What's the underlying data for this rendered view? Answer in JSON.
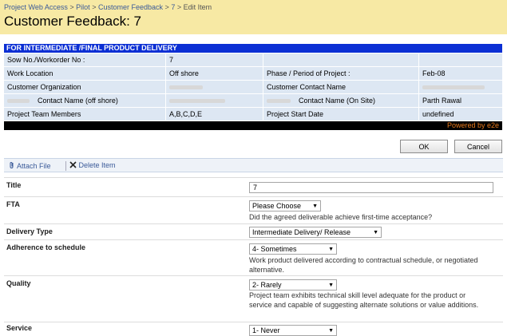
{
  "breadcrumb": [
    "Project Web Access",
    "Pilot",
    "Customer Feedback",
    "7",
    "Edit Item"
  ],
  "breadcrumb_sep": ">",
  "page_title": "Customer Feedback: 7",
  "info": {
    "header": "FOR INTERMEDIATE /FINAL PRODUCT DELIVERY",
    "rows": [
      [
        "Sow No./Workorder No :",
        "7",
        "",
        ""
      ],
      [
        "Work Location",
        "Off shore",
        "Phase / Period of Project :",
        "Feb-08"
      ],
      [
        "Customer Organization",
        "",
        "Customer Contact Name",
        ""
      ],
      [
        "Contact Name (off shore)",
        "",
        "Contact Name (On Site)",
        "Parth Rawal"
      ],
      [
        "Project Team Members",
        "A,B,C,D,E",
        "Project Start Date",
        "undefined"
      ]
    ],
    "powered": "Powered by e2e"
  },
  "buttons": {
    "ok": "OK",
    "cancel": "Cancel"
  },
  "toolbar": {
    "attach": "Attach File",
    "delete": "Delete Item"
  },
  "form": {
    "title_label": "Title",
    "title_value": "7",
    "fta_label": "FTA",
    "fta_value": "Please Choose",
    "fta_desc": "Did the agreed deliverable achieve first-time acceptance?",
    "delivery_label": "Delivery Type",
    "delivery_value": "Intermediate Delivery/ Release",
    "adherence_label": "Adherence to schedule",
    "adherence_value": "4- Sometimes",
    "adherence_desc": "Work product delivered according to contractual schedule, or negotiated alternative.",
    "quality_label": "Quality",
    "quality_value": "2- Rarely",
    "quality_desc": "Project team exhibits technical skill level adequate for the product or service and capable of suggesting alternate solutions or value additions.",
    "service_label": "Service",
    "service_value": "1- Never"
  }
}
